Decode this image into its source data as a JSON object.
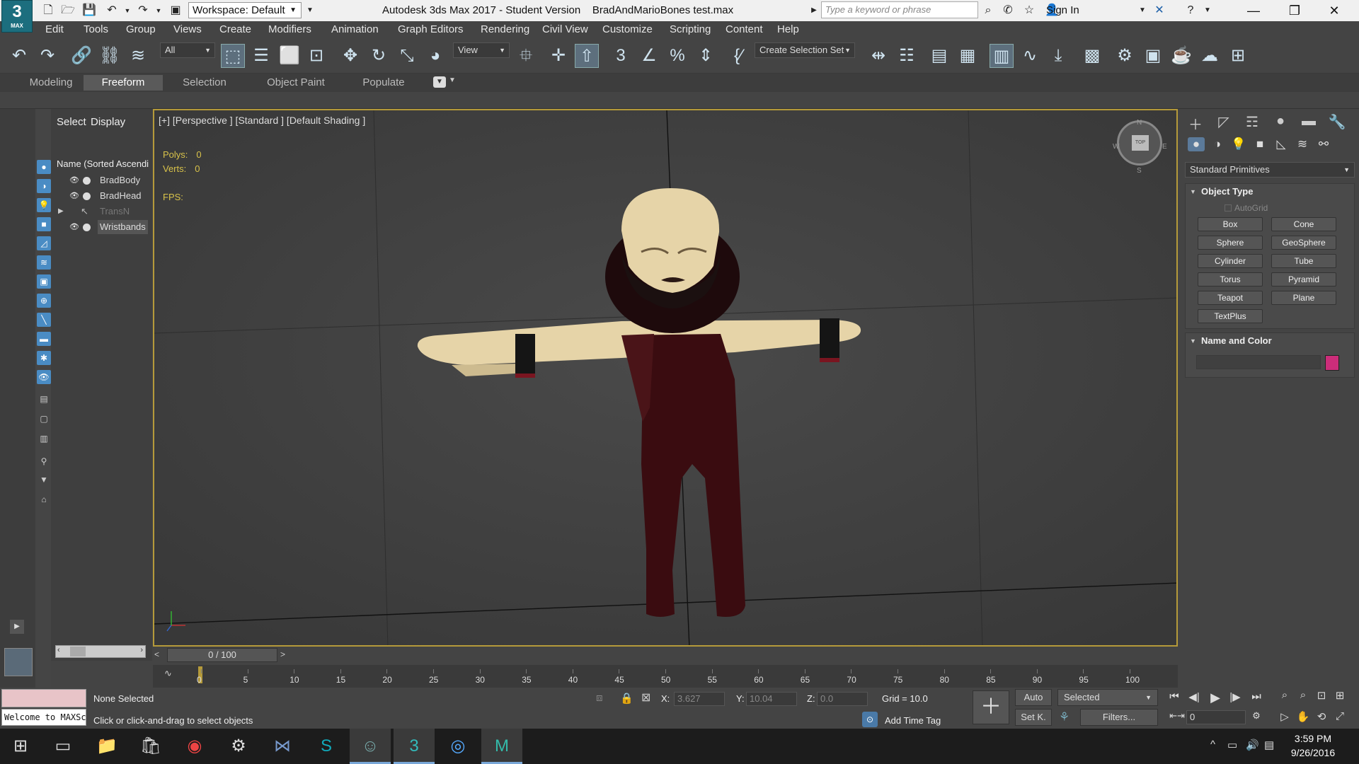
{
  "window": {
    "logo_text": "3",
    "logo_sub": "MAX",
    "workspace": "Workspace: Default",
    "title": "Autodesk 3ds Max 2017 - Student Version    BradAndMarioBones test.max",
    "search_placeholder": "Type a keyword or phrase",
    "sign_in": "Sign In"
  },
  "menu": [
    "Edit",
    "Tools",
    "Group",
    "Views",
    "Create",
    "Modifiers",
    "Animation",
    "Graph Editors",
    "Rendering",
    "Civil View",
    "Customize",
    "Scripting",
    "Content",
    "Help"
  ],
  "toolbar": {
    "selection_filter": "All",
    "ref_coord": "View",
    "selection_set": "Create Selection Set"
  },
  "ribbon_tabs": [
    "Modeling",
    "Freeform",
    "Selection",
    "Object Paint",
    "Populate"
  ],
  "ribbon_active": "Freeform",
  "explorer": {
    "tabs": [
      "Select",
      "Display"
    ],
    "header": "Name (Sorted Ascending)",
    "items": [
      {
        "name": "BradBody"
      },
      {
        "name": "BradHead"
      },
      {
        "name": "TransN"
      },
      {
        "name": "Wristbands"
      }
    ]
  },
  "viewport": {
    "label": "[+] [Perspective ] [Standard ] [Default Shading ]",
    "polys_label": "Polys:",
    "polys": "0",
    "verts_label": "Verts:",
    "verts": "0",
    "fps_label": "FPS:",
    "cube_face": "TOP",
    "compass": {
      "n": "N",
      "s": "S",
      "e": "E",
      "w": "W"
    }
  },
  "command_panel": {
    "category": "Standard Primitives",
    "object_type_title": "Object Type",
    "autogrid": "AutoGrid",
    "buttons": [
      "Box",
      "Cone",
      "Sphere",
      "GeoSphere",
      "Cylinder",
      "Tube",
      "Torus",
      "Pyramid",
      "Teapot",
      "Plane",
      "TextPlus"
    ],
    "name_color_title": "Name and Color",
    "color": "#cc2d7a"
  },
  "timeline": {
    "frame": "0 / 100",
    "ticks": [
      "0",
      "5",
      "10",
      "15",
      "20",
      "25",
      "30",
      "35",
      "40",
      "45",
      "50",
      "55",
      "60",
      "65",
      "70",
      "75",
      "80",
      "85",
      "90",
      "95",
      "100"
    ]
  },
  "status": {
    "selection": "None Selected",
    "prompt": "Click or click-and-drag to select objects",
    "maxscript": "Welcome to MAXScript.",
    "x_label": "X:",
    "x": "3.627",
    "y_label": "Y:",
    "y": "10.04",
    "z_label": "Z:",
    "z": "0.0",
    "grid": "Grid = 10.0",
    "add_time_tag": "Add Time Tag",
    "auto": "Auto",
    "set_key": "Set K.",
    "key_mode": "Selected",
    "filters": "Filters...",
    "current_frame": "0"
  },
  "taskbar": {
    "time": "3:59 PM",
    "date": "9/26/2016"
  }
}
